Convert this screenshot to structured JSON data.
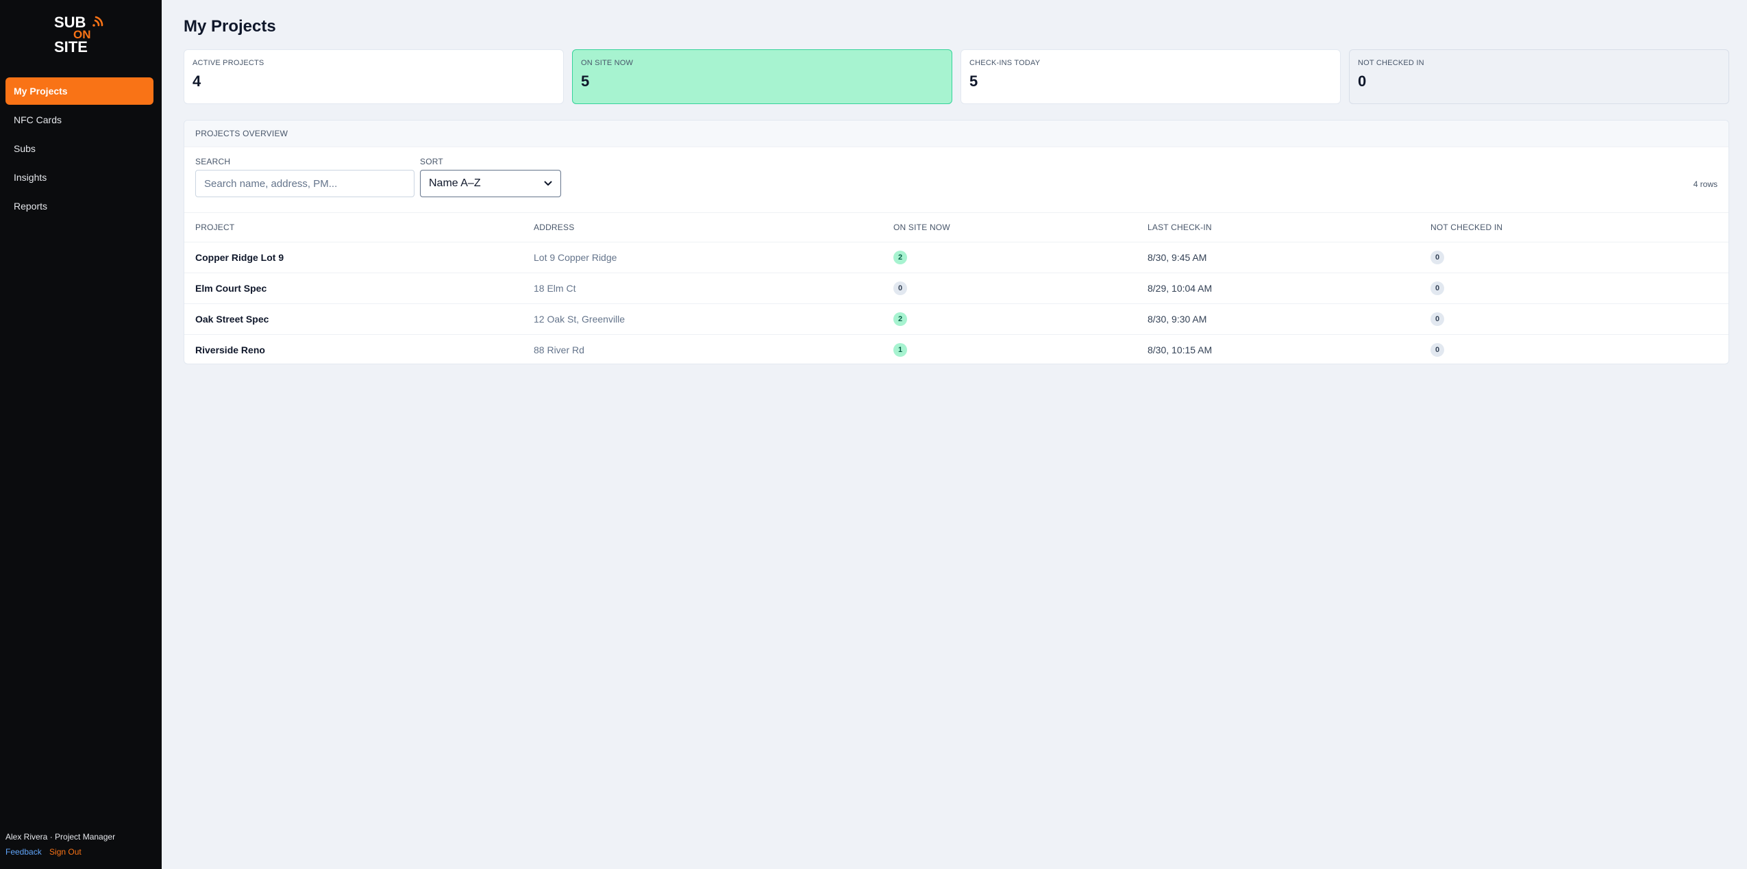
{
  "logo": {
    "line1": "SUB",
    "line2": "ON",
    "line3": "SITE"
  },
  "sidebar": {
    "items": [
      {
        "label": "My Projects",
        "active": true
      },
      {
        "label": "NFC Cards",
        "active": false
      },
      {
        "label": "Subs",
        "active": false
      },
      {
        "label": "Insights",
        "active": false
      },
      {
        "label": "Reports",
        "active": false
      }
    ],
    "user": "Alex Rivera · Project Manager",
    "feedback_label": "Feedback",
    "signout_label": "Sign Out"
  },
  "page": {
    "title": "My Projects"
  },
  "stats": [
    {
      "label": "ACTIVE PROJECTS",
      "value": "4"
    },
    {
      "label": "ON SITE NOW",
      "value": "5"
    },
    {
      "label": "CHECK-INS TODAY",
      "value": "5"
    },
    {
      "label": "NOT CHECKED IN",
      "value": "0"
    }
  ],
  "panel": {
    "title": "PROJECTS OVERVIEW",
    "search_label": "SEARCH",
    "search_placeholder": "Search name, address, PM...",
    "search_value": "",
    "sort_label": "SORT",
    "sort_value": "Name A–Z",
    "row_count": "4 rows"
  },
  "table": {
    "headers": [
      "PROJECT",
      "ADDRESS",
      "ON SITE NOW",
      "LAST CHECK-IN",
      "NOT CHECKED IN"
    ],
    "rows": [
      {
        "project": "Copper Ridge Lot 9",
        "address": "Lot 9 Copper Ridge",
        "on_site": "2",
        "last_checkin": "8/30, 9:45 AM",
        "not_checked_in": "0"
      },
      {
        "project": "Elm Court Spec",
        "address": "18 Elm Ct",
        "on_site": "0",
        "last_checkin": "8/29, 10:04 AM",
        "not_checked_in": "0"
      },
      {
        "project": "Oak Street Spec",
        "address": "12 Oak St, Greenville",
        "on_site": "2",
        "last_checkin": "8/30, 9:30 AM",
        "not_checked_in": "0"
      },
      {
        "project": "Riverside Reno",
        "address": "88 River Rd",
        "on_site": "1",
        "last_checkin": "8/30, 10:15 AM",
        "not_checked_in": "0"
      }
    ]
  },
  "colors": {
    "accent": "#f97316",
    "sidebar_bg": "#0b0c0e",
    "success_bg": "#a7f3d0",
    "success_border": "#34d399"
  }
}
